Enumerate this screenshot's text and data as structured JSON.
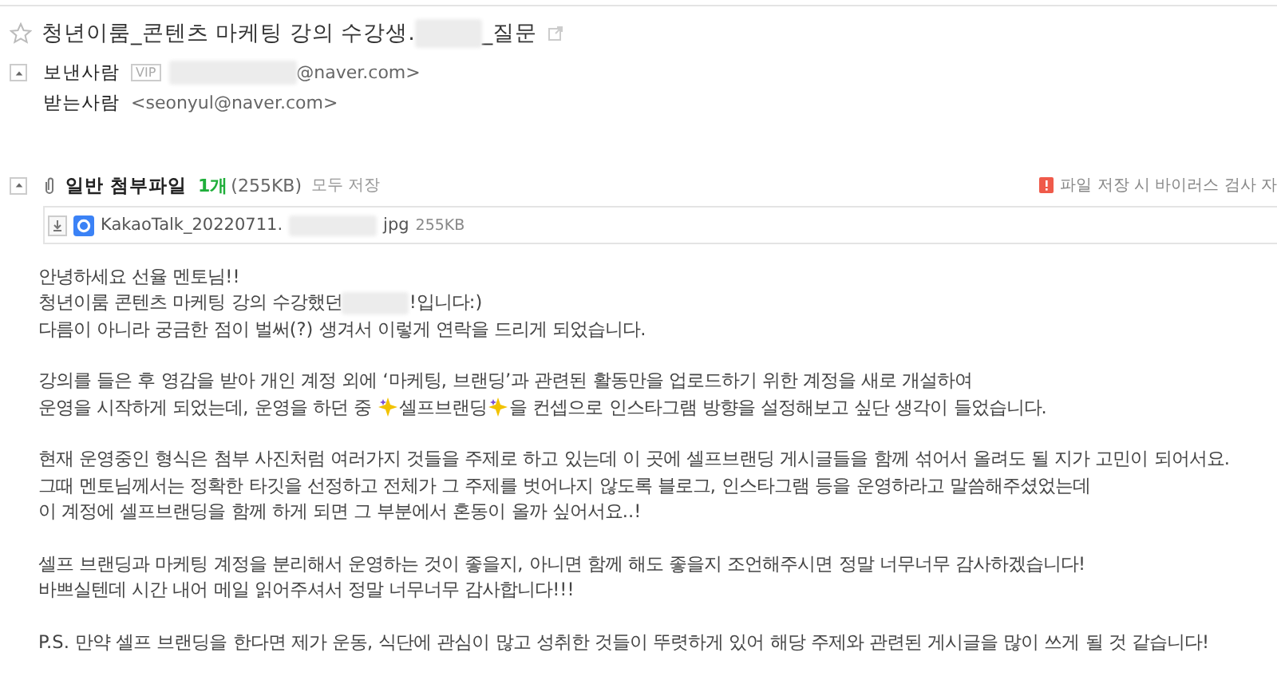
{
  "subject": {
    "starred": false,
    "parts": [
      "청년이룸_콘텐츠 마케팅 강의 수강생.",
      "_질문"
    ]
  },
  "sender": {
    "label": "보낸사람",
    "badge": "VIP",
    "address": "@naver.com>"
  },
  "recipient": {
    "label": "받는사람",
    "address": "<seonyul@naver.com>"
  },
  "attachments": {
    "label": "일반 첨부파일",
    "count": "1개",
    "size": "(255KB)",
    "save_all": "모두 저장",
    "notice": "파일 저장 시 바이러스 검사 자",
    "files": [
      {
        "name_parts": [
          "KakaoTalk_20220711.",
          "jpg"
        ],
        "size": "255KB"
      }
    ]
  },
  "body": [
    {
      "lines": [
        {
          "parts": [
            "안녕하세요 선율 멘토님!!"
          ]
        },
        {
          "parts": [
            "청년이룸 콘텐츠 마케팅 강의 수강했던",
            "!입니다:)"
          ],
          "kind": "redaction"
        },
        {
          "parts": [
            "다름이 아니라 궁금한 점이 벌써(?) 생겨서 이렇게 연락을 드리게 되었습니다."
          ]
        }
      ]
    },
    {
      "lines": [
        {
          "parts": [
            "강의를 들은 후 영감을 받아 개인 계정 외에 ‘마케팅, 브랜딩’과 관련된 활동만을 업로드하기 위한 계정을 새로 개설하여"
          ]
        },
        {
          "parts": [
            "운영을 시작하게 되었는데, 운영을 하던 중 ",
            "셀프브랜딩",
            "을 컨셉으로 인스타그램 방향을 설정해보고 싶단 생각이 들었습니다."
          ],
          "kind": "sparkle"
        }
      ]
    },
    {
      "lines": [
        {
          "parts": [
            "현재 운영중인 형식은 첨부 사진처럼 여러가지 것들을 주제로 하고 있는데 이 곳에 셀프브랜딩 게시글들을 함께 섞어서 올려도 될 지가 고민이 되어서요."
          ]
        },
        {
          "parts": [
            "그때 멘토님께서는 정확한 타깃을 선정하고 전체가 그 주제를 벗어나지 않도록 블로그, 인스타그램 등을 운영하라고 말씀해주셨었는데"
          ]
        },
        {
          "parts": [
            "이 계정에 셀프브랜딩을 함께 하게 되면 그 부분에서 혼동이 올까 싶어서요..!"
          ]
        }
      ]
    },
    {
      "lines": [
        {
          "parts": [
            "셀프 브랜딩과 마케팅 계정을 분리해서 운영하는 것이 좋을지, 아니면 함께 해도 좋을지 조언해주시면 정말 너무너무 감사하겠습니다!"
          ]
        },
        {
          "parts": [
            "바쁘실텐데 시간 내어 메일 읽어주셔서 정말 너무너무 감사합니다!!!"
          ]
        }
      ]
    },
    {
      "lines": [
        {
          "parts": [
            "P.S. 만약 셀프 브랜딩을 한다면 제가 운동, 식단에 관심이 많고 성취한 것들이 뚜렷하게 있어 해당 주제와 관련된 게시글을 많이 쓰게 될 것 같습니다!"
          ]
        }
      ]
    }
  ]
}
